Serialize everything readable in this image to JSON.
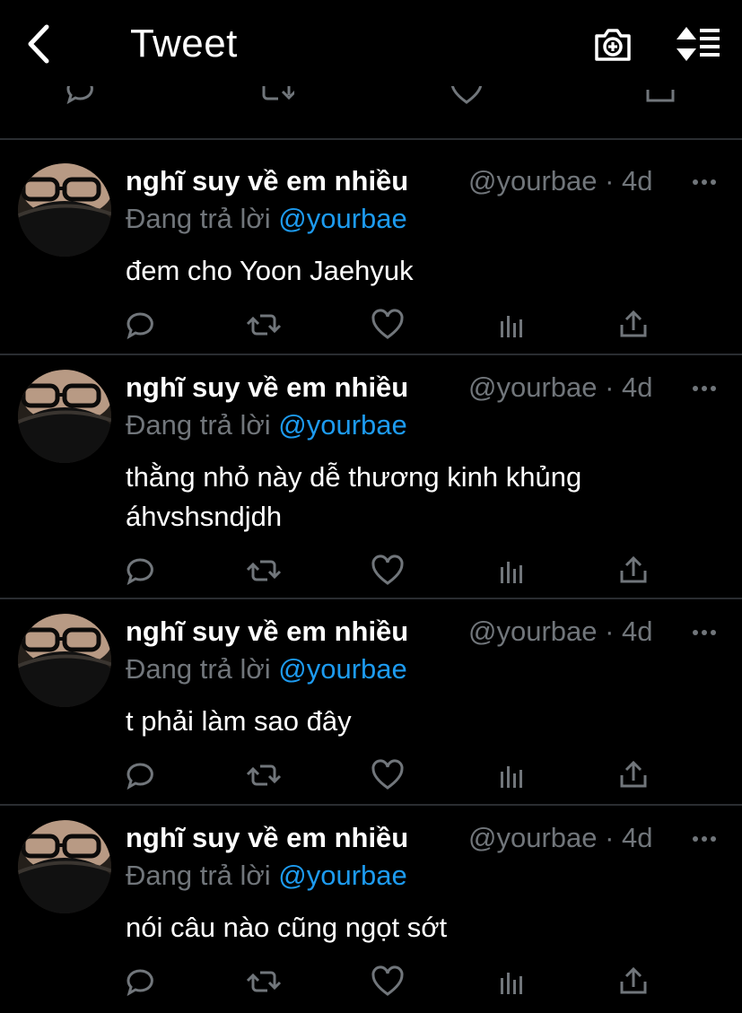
{
  "header": {
    "title": "Tweet",
    "back_icon": "chevron-left-icon",
    "camera_icon": "camera-plus-icon",
    "sort_icon": "sort-icon"
  },
  "colors": {
    "background": "#000000",
    "text": "#ffffff",
    "muted": "#71767b",
    "link": "#1d9bf0",
    "divider": "#2a2d31"
  },
  "tweets": [
    {
      "name": "nghĩ suy về em nhiều",
      "meta": "@yourbae · 4d",
      "reply_prefix": "Đang trả lời",
      "reply_handle": "@yourbae",
      "text": "đem cho Yoon Jaehyuk"
    },
    {
      "name": "nghĩ suy về em nhiều",
      "meta": "@yourbae · 4d",
      "reply_prefix": "Đang trả lời",
      "reply_handle": "@yourbae",
      "text": "thằng nhỏ này dễ thương kinh khủng áhvshsndjdh"
    },
    {
      "name": "nghĩ suy về em nhiều",
      "meta": "@yourbae · 4d",
      "reply_prefix": "Đang trả lời",
      "reply_handle": "@yourbae",
      "text": "t phải làm sao đây"
    },
    {
      "name": "nghĩ suy về em nhiều",
      "meta": "@yourbae · 4d",
      "reply_prefix": "Đang trả lời",
      "reply_handle": "@yourbae",
      "text": "nói câu nào cũng ngọt sớt"
    }
  ]
}
